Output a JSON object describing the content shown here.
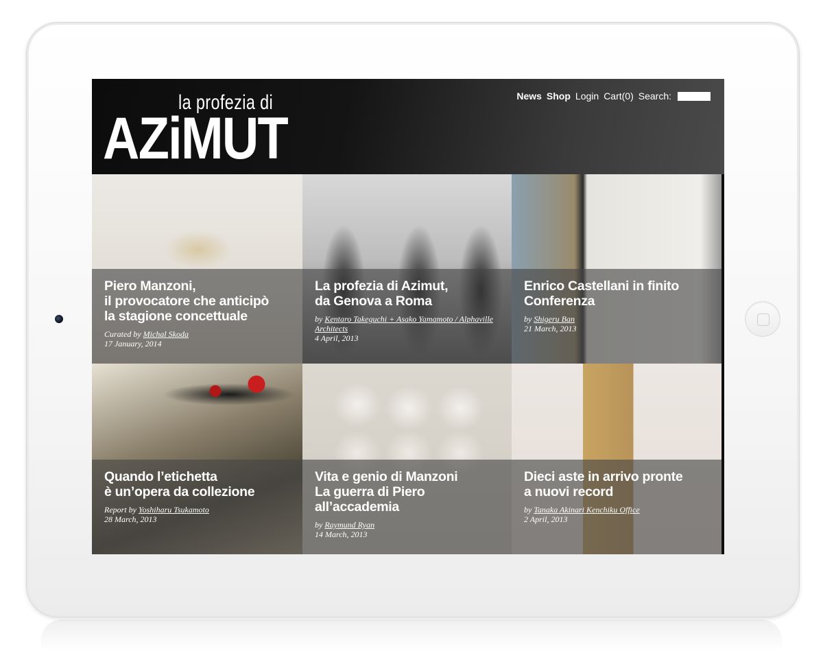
{
  "logo": {
    "line1": "la profezia di",
    "line2": "AZiMUT"
  },
  "nav": {
    "news": "News",
    "shop": "Shop",
    "login": "Login",
    "cart": "Cart(0)",
    "search_label": "Search:"
  },
  "tiles": [
    {
      "title": "Piero Manzoni,\nil provocatore che anticipò\nla stagione concettuale",
      "credit_prefix": "Curated by",
      "author": "Michal Skoda",
      "date": "17 January, 2014"
    },
    {
      "title": "La profezia di Azimut,\nda Genova a Roma",
      "credit_prefix": "by",
      "author": "Kentaro Takeguchi + Asako Yamamoto / Alphaville Architects",
      "date": "4 April, 2013"
    },
    {
      "title": "Enrico Castellani in finito\nConferenza",
      "credit_prefix": "by",
      "author": "Shigeru Ban",
      "date": "21 March, 2013"
    },
    {
      "title": "Quando l’etichetta\nè un’opera da collezione",
      "credit_prefix": "Report by",
      "author": "Yoshiharu Tsukamoto",
      "date": "28 March, 2013"
    },
    {
      "title": "Vita e genio di Manzoni\nLa guerra di Piero\nall’accademia",
      "credit_prefix": "by",
      "author": "Raymund Ryan",
      "date": "14 March, 2013"
    },
    {
      "title": "Dieci aste in arrivo pronte\na nuovi record",
      "credit_prefix": "by",
      "author": "Tanaka Akinari Kenchiku Office",
      "date": "2 April, 2013"
    }
  ]
}
